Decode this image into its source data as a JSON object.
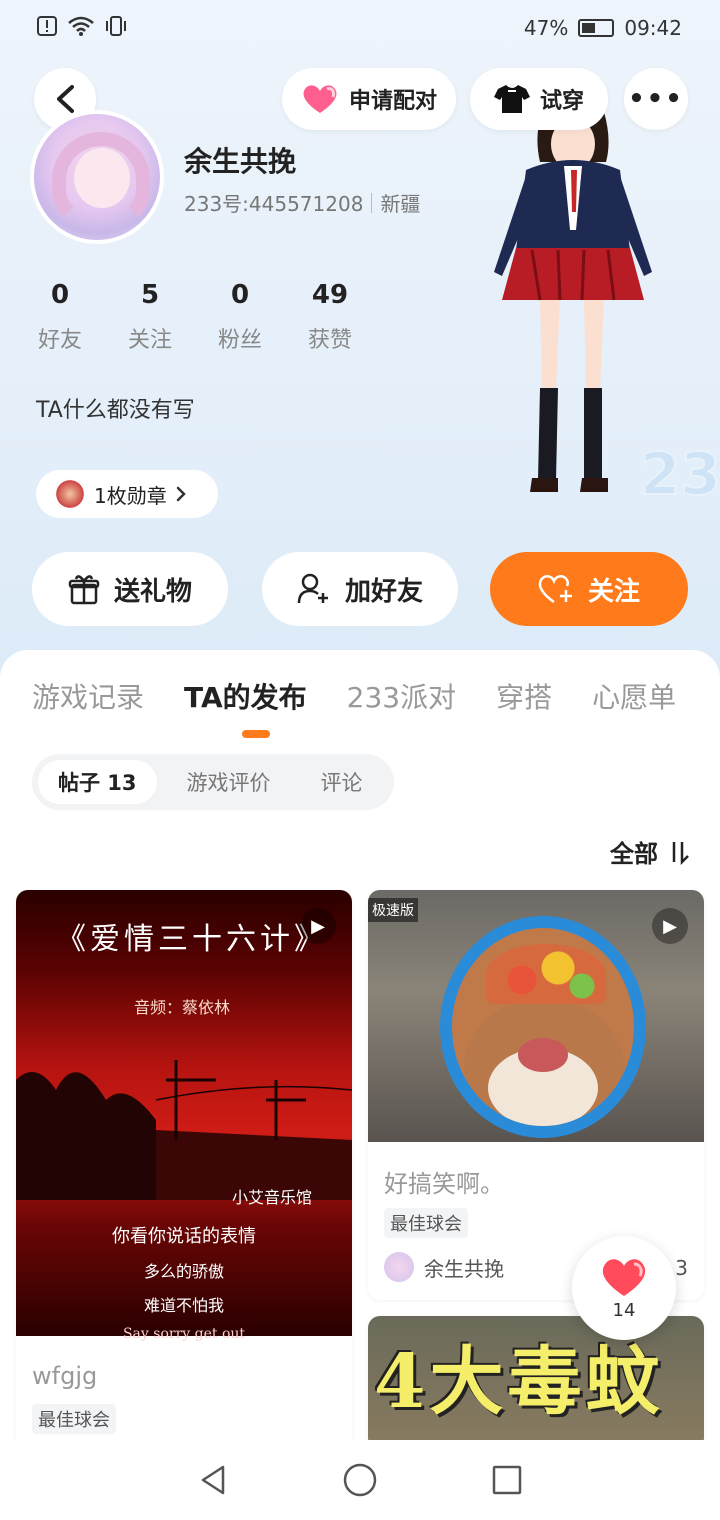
{
  "status_bar": {
    "battery": "47%",
    "time": "09:42"
  },
  "header": {
    "apply_label": "申请配对",
    "try_label": "试穿",
    "more_label": "•••"
  },
  "profile": {
    "username": "余生共挽",
    "user_id": "233号:445571208",
    "region": "新疆",
    "stats": [
      {
        "value": "0",
        "label": "好友"
      },
      {
        "value": "5",
        "label": "关注"
      },
      {
        "value": "0",
        "label": "粉丝"
      },
      {
        "value": "49",
        "label": "获赞"
      }
    ],
    "bio": "TA什么都没有写",
    "badge_label": "1枚勋章"
  },
  "actions": {
    "gift": "送礼物",
    "add_friend": "加好友",
    "follow": "关注"
  },
  "tabs": [
    "游戏记录",
    "TA的发布",
    "233派对",
    "穿搭",
    "心愿单"
  ],
  "subtabs": [
    "帖子 13",
    "游戏评价",
    "评论"
  ],
  "sort_label": "全部",
  "posts": [
    {
      "title": "wfgjg",
      "tag": "最佳球会",
      "thumb_title": "《爱情三十六计》",
      "thumb_subtitle": "音频：蔡依林",
      "thumb_brand": "小艾音乐馆",
      "thumb_lyrics": [
        "你看你说话的表情",
        "多么的骄傲",
        "难道不怕我",
        "Say sorry get out"
      ]
    },
    {
      "title": "好搞笑啊。",
      "tag": "最佳球会",
      "author": "余生共挽",
      "likes": "3",
      "thumb_corner": "极速版"
    },
    {
      "thumb_title": "4大毒蚊"
    }
  ],
  "floating_like_count": "14",
  "colors": {
    "accent": "#ff7a1a",
    "heart": "#ff4b5c"
  }
}
